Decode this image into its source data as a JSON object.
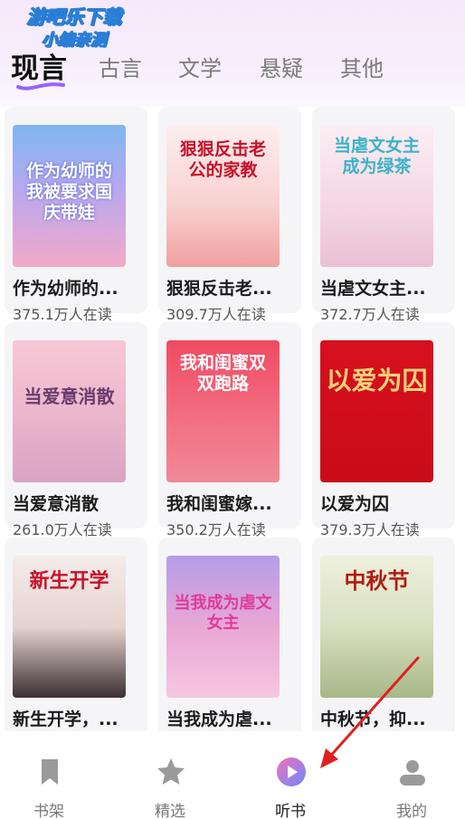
{
  "watermark": {
    "line1": "游吧乐下载",
    "line2": "小编亲测"
  },
  "tabs": [
    {
      "label": "现言",
      "active": true
    },
    {
      "label": "古言",
      "active": false
    },
    {
      "label": "文学",
      "active": false
    },
    {
      "label": "悬疑",
      "active": false
    },
    {
      "label": "其他",
      "active": false
    }
  ],
  "books": [
    {
      "title": "作为幼师的...",
      "reads": "375.1万人在读",
      "cover_text": "作为幼师的我被要求国庆带娃"
    },
    {
      "title": "狠狠反击老...",
      "reads": "309.7万人在读",
      "cover_text": "狠狠反击老公的家教"
    },
    {
      "title": "当虐文女主...",
      "reads": "372.7万人在读",
      "cover_text": "当虐文女主成为绿茶"
    },
    {
      "title": "当爱意消散",
      "reads": "261.0万人在读",
      "cover_text": "当爱意消散"
    },
    {
      "title": "我和闺蜜嫁...",
      "reads": "350.2万人在读",
      "cover_text": "我和闺蜜双双跑路"
    },
    {
      "title": "以爱为囚",
      "reads": "379.3万人在读",
      "cover_text": "以爱为囚"
    },
    {
      "title": "新生开学，...",
      "reads": "",
      "cover_text": "新生开学"
    },
    {
      "title": "当我成为虐...",
      "reads": "",
      "cover_text": "当我成为虐文女主"
    },
    {
      "title": "中秋节，抑...",
      "reads": "",
      "cover_text": "中秋节"
    }
  ],
  "bottom_nav": [
    {
      "label": "书架",
      "icon": "bookmark-icon",
      "active": false
    },
    {
      "label": "精选",
      "icon": "star-icon",
      "active": false
    },
    {
      "label": "听书",
      "icon": "play-icon",
      "active": true
    },
    {
      "label": "我的",
      "icon": "user-icon",
      "active": false
    }
  ],
  "colors": {
    "accent_gradient_start": "#f26fb5",
    "accent_gradient_end": "#6c8bff",
    "arrow": "#e02020"
  }
}
